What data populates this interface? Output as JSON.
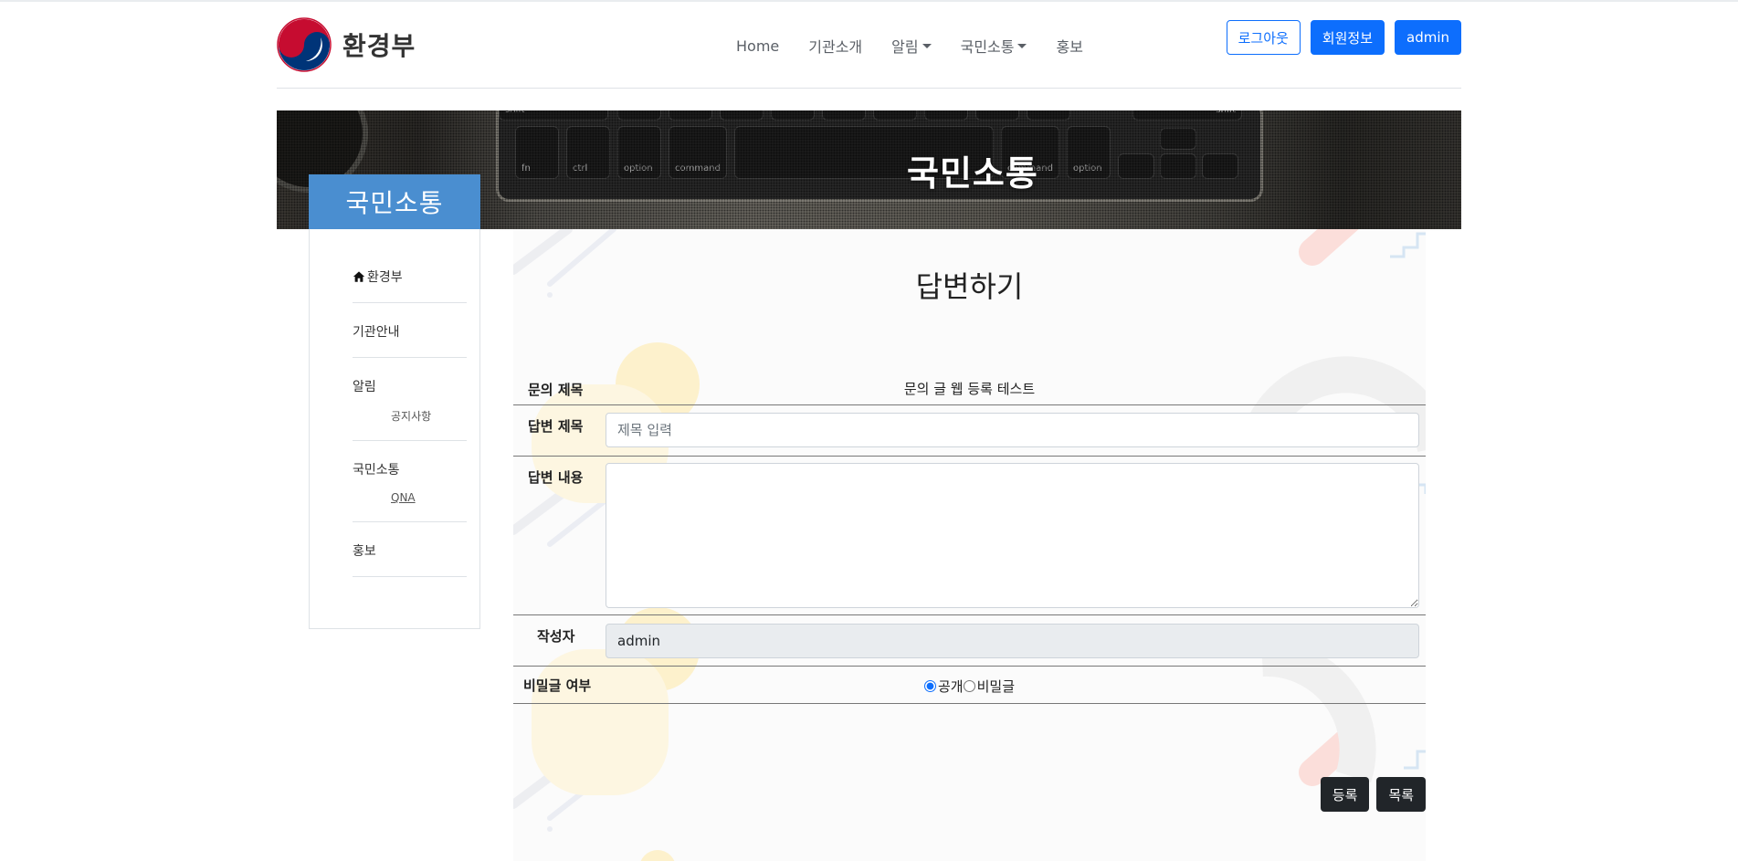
{
  "header": {
    "logo_text": "환경부",
    "nav": [
      {
        "label": "Home",
        "has_dropdown": false
      },
      {
        "label": "기관소개",
        "has_dropdown": false
      },
      {
        "label": "알림",
        "has_dropdown": true
      },
      {
        "label": "국민소통",
        "has_dropdown": true
      },
      {
        "label": "홍보",
        "has_dropdown": false
      }
    ],
    "buttons": {
      "logout": "로그아웃",
      "member_info": "회원정보",
      "user": "admin"
    }
  },
  "banner": {
    "title": "국민소통",
    "keys": [
      "shift",
      "shift",
      "fn",
      "ctrl",
      "option",
      "command",
      "command",
      "option"
    ]
  },
  "sidebar": {
    "title": "국민소통",
    "items": [
      {
        "label": "환경부",
        "icon": "home-icon",
        "sub": null
      },
      {
        "label": "기관안내",
        "sub": null
      },
      {
        "label": "알림",
        "sub": "공지사항"
      },
      {
        "label": "국민소통",
        "sub": "QNA"
      },
      {
        "label": "홍보",
        "sub": null
      }
    ]
  },
  "content": {
    "title": "답변하기",
    "inquiry_title_label": "문의 제목",
    "inquiry_title_value": "문의 글 웹 등록 테스트",
    "answer_title_label": "답변 제목",
    "answer_title_placeholder": "제목 입력",
    "answer_body_label": "답변 내용",
    "author_label": "작성자",
    "author_value": "admin",
    "secret_label": "비밀글 여부",
    "option_public": "공개",
    "option_secret": "비밀글",
    "submit": "등록",
    "list": "목록"
  },
  "colors": {
    "primary": "#0d6efd",
    "sidebar_title_bg": "#4a8ed0",
    "dark_button": "#212529"
  }
}
